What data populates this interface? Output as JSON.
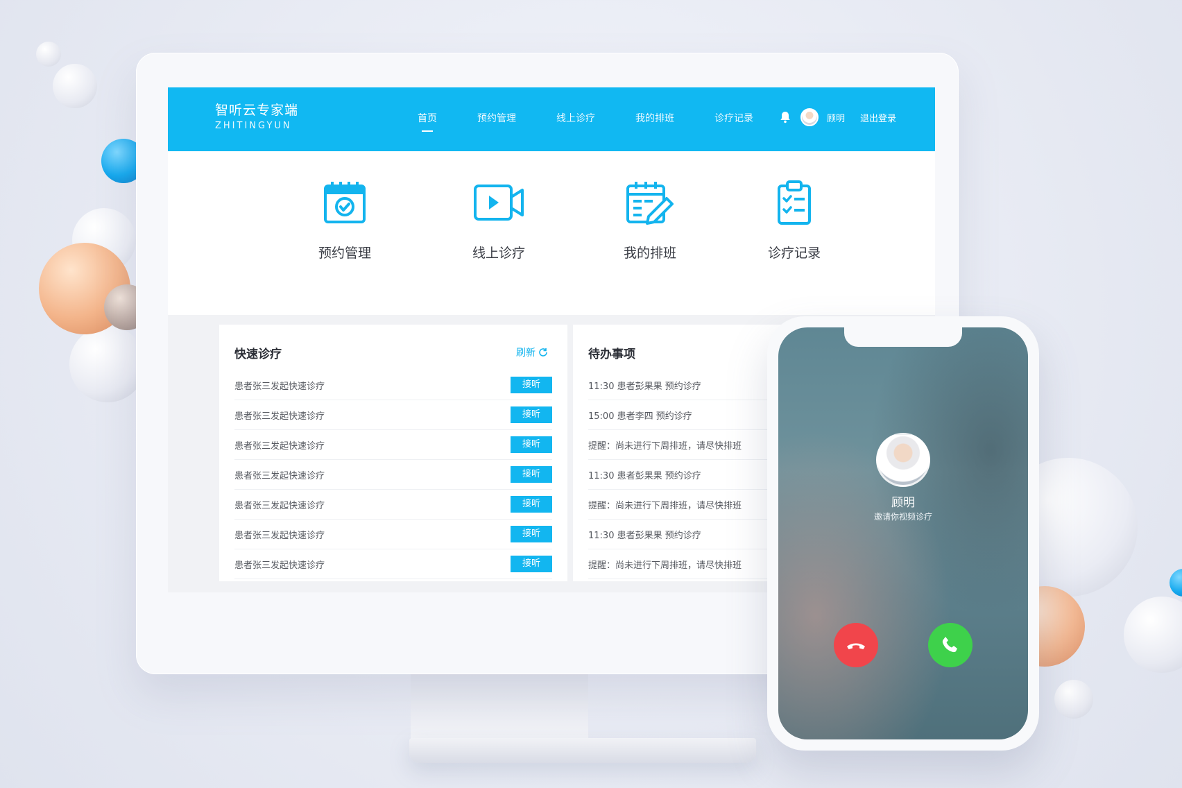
{
  "brand": {
    "title": "智听云专家端",
    "subtitle": "ZHITINGYUN"
  },
  "nav": {
    "items": [
      {
        "label": "首页"
      },
      {
        "label": "预约管理"
      },
      {
        "label": "线上诊疗"
      },
      {
        "label": "我的排班"
      },
      {
        "label": "诊疗记录"
      }
    ]
  },
  "user": {
    "name": "顾明",
    "logout": "退出登录"
  },
  "quick": {
    "items": [
      {
        "label": "预约管理",
        "icon": "calendar-check-icon"
      },
      {
        "label": "线上诊疗",
        "icon": "video-camera-icon"
      },
      {
        "label": "我的排班",
        "icon": "schedule-edit-icon"
      },
      {
        "label": "诊疗记录",
        "icon": "clipboard-check-icon"
      }
    ]
  },
  "quick_consult": {
    "title": "快速诊疗",
    "refresh": "刷新",
    "items": [
      {
        "text": "患者张三发起快速诊疗",
        "button": "接听"
      },
      {
        "text": "患者张三发起快速诊疗",
        "button": "接听"
      },
      {
        "text": "患者张三发起快速诊疗",
        "button": "接听"
      },
      {
        "text": "患者张三发起快速诊疗",
        "button": "接听"
      },
      {
        "text": "患者张三发起快速诊疗",
        "button": "接听"
      },
      {
        "text": "患者张三发起快速诊疗",
        "button": "接听"
      },
      {
        "text": "患者张三发起快速诊疗",
        "button": "接听"
      }
    ]
  },
  "todo": {
    "title": "待办事项",
    "items": [
      {
        "text": "11:30 患者彭果果 预约诊疗"
      },
      {
        "text": "15:00 患者李四 预约诊疗"
      },
      {
        "text": "提醒：尚未进行下周排班，请尽快排班"
      },
      {
        "text": "11:30 患者彭果果 预约诊疗"
      },
      {
        "text": "提醒：尚未进行下周排班，请尽快排班"
      },
      {
        "text": "11:30 患者彭果果 预约诊疗"
      },
      {
        "text": "提醒：尚未进行下周排班，请尽快排班"
      }
    ]
  },
  "phone": {
    "caller_name": "顾明",
    "caller_message": "邀请你视频诊疗"
  },
  "colors": {
    "primary": "#11b8f2",
    "decline": "#f1454b",
    "accept": "#3ed14b"
  }
}
